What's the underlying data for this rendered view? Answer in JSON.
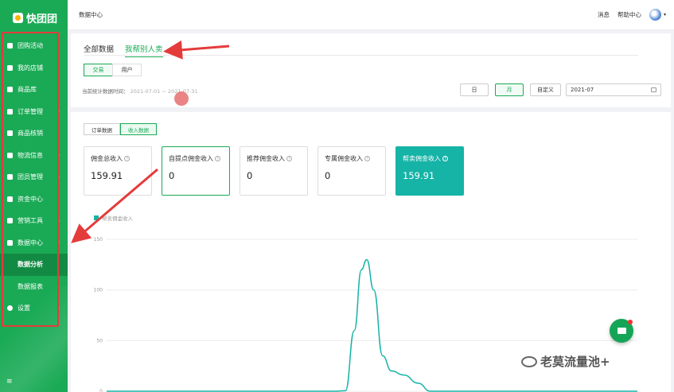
{
  "app": {
    "title": "快团团"
  },
  "sidebar": {
    "items": [
      {
        "label": "团购活动",
        "icon": "flag-icon",
        "caret": ""
      },
      {
        "label": "我的店铺",
        "icon": "store-icon",
        "caret": ""
      },
      {
        "label": "商品库",
        "icon": "cube-icon",
        "caret": ""
      },
      {
        "label": "订单管理",
        "icon": "order-icon",
        "caret": "›"
      },
      {
        "label": "商品核销",
        "icon": "verify-icon",
        "caret": ""
      },
      {
        "label": "物流信息",
        "icon": "truck-icon",
        "caret": "›"
      },
      {
        "label": "团员管理",
        "icon": "user-icon",
        "caret": "›"
      },
      {
        "label": "资金中心",
        "icon": "money-icon",
        "caret": ""
      },
      {
        "label": "营销工具",
        "icon": "tag-icon",
        "caret": "›"
      },
      {
        "label": "数据中心",
        "icon": "bar-chart-icon",
        "caret": "‹"
      }
    ],
    "sub_items": [
      {
        "label": "数据分析"
      },
      {
        "label": "数据报表"
      }
    ],
    "settings": {
      "label": "设置",
      "icon": "gear-icon",
      "caret": "›"
    },
    "footer_icon": "≡"
  },
  "topbar": {
    "breadcrumb": "数据中心",
    "links": [
      "消息",
      "帮助中心"
    ],
    "dropdown": "▾"
  },
  "filter": {
    "main_tabs": [
      "全部数据",
      "我帮别人卖"
    ],
    "seg_tabs": [
      "交易",
      "用户"
    ],
    "range_label": "当前统计数据时间：",
    "range_value": "2021-07-01 ~ 2021-07-31",
    "period_buttons": [
      "日",
      "月",
      "自定义"
    ],
    "month_value": "2021-07"
  },
  "data": {
    "sub_tabs": [
      "订单数据",
      "收入数据"
    ],
    "cards": [
      {
        "label": "佣金总收入",
        "value": "159.91"
      },
      {
        "label": "自提点佣金收入",
        "value": "0"
      },
      {
        "label": "推荐佣金收入",
        "value": "0"
      },
      {
        "label": "专属佣金收入",
        "value": "0"
      },
      {
        "label": "帮卖佣金收入",
        "value": "159.91"
      }
    ],
    "question_mark": "?"
  },
  "chart_data": {
    "type": "line",
    "series": [
      {
        "name": "帮卖佣金收入",
        "color": "#16b3a7",
        "points": [
          [
            1,
            0
          ],
          [
            2,
            0
          ],
          [
            3,
            0
          ],
          [
            4,
            0
          ],
          [
            5,
            0
          ],
          [
            6,
            0
          ],
          [
            7,
            0
          ],
          [
            8,
            0
          ],
          [
            9,
            0
          ],
          [
            10,
            0
          ],
          [
            11,
            0
          ],
          [
            12,
            0
          ],
          [
            13,
            0
          ],
          [
            14,
            0
          ],
          [
            14.5,
            0.5
          ],
          [
            15,
            60
          ],
          [
            15.4,
            120
          ],
          [
            15.7,
            130
          ],
          [
            16.1,
            100
          ],
          [
            16.6,
            35
          ],
          [
            17.1,
            20
          ],
          [
            17.8,
            16
          ],
          [
            18.6,
            8
          ],
          [
            19.3,
            0
          ],
          [
            20,
            0
          ],
          [
            21,
            0
          ],
          [
            22,
            0
          ],
          [
            23,
            0
          ],
          [
            24,
            0
          ],
          [
            25,
            0
          ],
          [
            26,
            0
          ],
          [
            27,
            0
          ],
          [
            28,
            0
          ],
          [
            29,
            0
          ],
          [
            30,
            0
          ],
          [
            31,
            0
          ]
        ]
      }
    ],
    "ylim": [
      0,
      150
    ],
    "yticks": [
      "150",
      "100",
      "50",
      "0"
    ],
    "xlim": [
      1,
      31
    ],
    "grid": true,
    "legend_position": "top-left"
  },
  "watermark": {
    "text": "老莫流量池+"
  },
  "colors": {
    "brand": "#1aaa55",
    "accent": "#16b3a7",
    "annotation": "#e43b3b"
  }
}
